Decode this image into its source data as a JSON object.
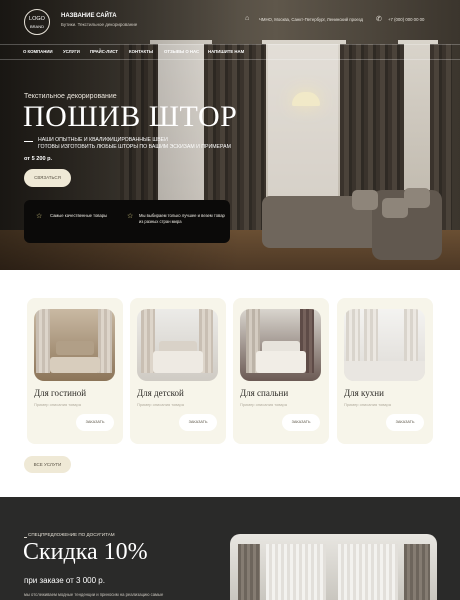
{
  "header": {
    "logo_text": "LOGO",
    "logo_sub": "BRAND",
    "site_name": "НАЗВАНИЕ САЙТА",
    "site_tagline": "Бутики. Текстильное декорирование",
    "address": "ЧМНО, Москва, Санкт-Петербург, Ленинский проезд",
    "phone": "+7 (000) 000 00 00"
  },
  "nav": {
    "items": [
      {
        "label": "О КОМПАНИИ"
      },
      {
        "label": "УСЛУГИ"
      },
      {
        "label": "ПРАЙС-ЛИСТ"
      },
      {
        "label": "КОНТАКТЫ"
      },
      {
        "label": "ОТЗЫВЫ О НАС"
      },
      {
        "label": "НАПИШИТЕ НАМ"
      }
    ]
  },
  "hero": {
    "eyebrow": "Текстильное декорирование",
    "title": "ПОШИВ ШТОР",
    "subtitle_line1": "НАШИ ОПЫТНЫЕ И КВАЛИФИЦИРОВАННЫЕ ШВЕИ",
    "subtitle_line2": "ГОТОВЫ ИЗГОТОВИТЬ ЛЮБЫЕ ШТОРЫ ПО ВАШИМ ЭСКИЗАМ И ПРИМЕРАМ",
    "price": "от 5 200 р.",
    "cta_label": "СВЯЗАТЬСЯ",
    "features": [
      {
        "text": "Самые качественные товары"
      },
      {
        "text": "Мы выбираем только лучшее и везем товар из разных стран мира"
      }
    ]
  },
  "cards": [
    {
      "title": "Для гостиной",
      "subtitle": "Пример описания товара",
      "button": "ЗАКАЗАТЬ"
    },
    {
      "title": "Для детской",
      "subtitle": "Пример описания товара",
      "button": "ЗАКАЗАТЬ"
    },
    {
      "title": "Для спальни",
      "subtitle": "Пример описания товара",
      "button": "ЗАКАЗАТЬ"
    },
    {
      "title": "Для кухни",
      "subtitle": "Пример описания товара",
      "button": "ЗАКАЗАТЬ"
    }
  ],
  "all_services_label": "ВСЕ УСЛУГИ",
  "promo": {
    "eyebrow": "СПЕЦПРЕДЛОЖЕНИЕ ПО ДОСУГИТАМ",
    "title": "Скидка 10%",
    "condition": "при заказе от 3 000 р.",
    "desc": "мы отслеживаем модные тенденции и приносим на реализацию самые"
  },
  "colors": {
    "accent_button": "#efe9d6",
    "card_bg": "#f7f5ea",
    "promo_bg": "#2a2a29",
    "feature_box": "#0b0a09",
    "star": "#e3d88b"
  },
  "icons": [
    "home-icon",
    "phone-icon",
    "star-icon"
  ]
}
